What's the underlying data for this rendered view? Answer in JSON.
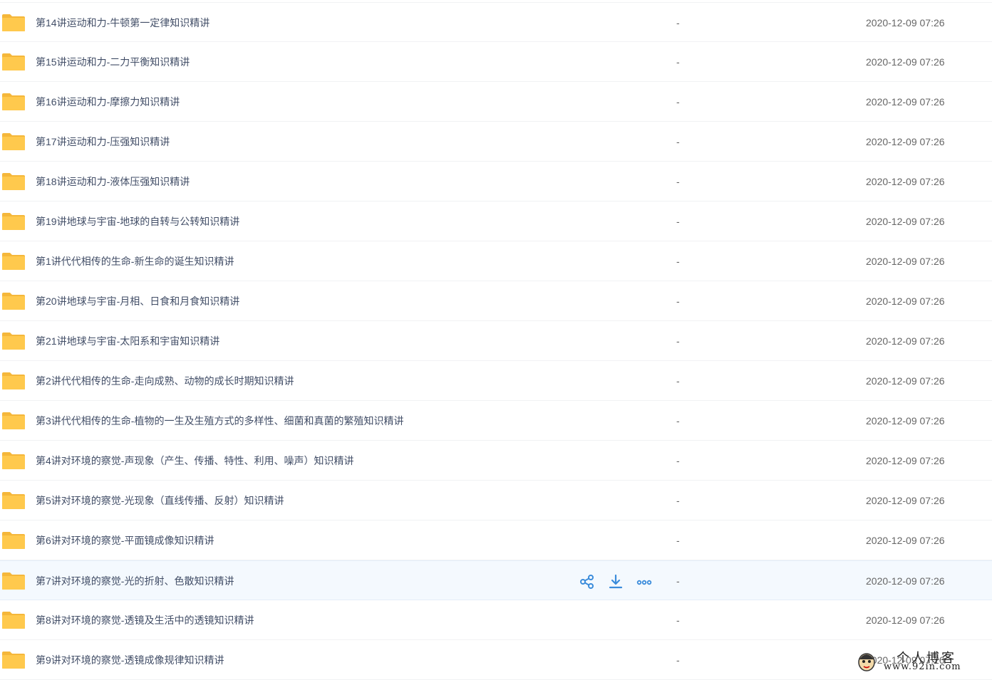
{
  "files": [
    {
      "name": "第14讲运动和力-牛顿第一定律知识精讲",
      "size": "-",
      "time": "2020-12-09 07:26"
    },
    {
      "name": "第15讲运动和力-二力平衡知识精讲",
      "size": "-",
      "time": "2020-12-09 07:26"
    },
    {
      "name": "第16讲运动和力-摩擦力知识精讲",
      "size": "-",
      "time": "2020-12-09 07:26"
    },
    {
      "name": "第17讲运动和力-压强知识精讲",
      "size": "-",
      "time": "2020-12-09 07:26"
    },
    {
      "name": "第18讲运动和力-液体压强知识精讲",
      "size": "-",
      "time": "2020-12-09 07:26"
    },
    {
      "name": "第19讲地球与宇宙-地球的自转与公转知识精讲",
      "size": "-",
      "time": "2020-12-09 07:26"
    },
    {
      "name": "第1讲代代相传的生命-新生命的诞生知识精讲",
      "size": "-",
      "time": "2020-12-09 07:26"
    },
    {
      "name": "第20讲地球与宇宙-月相、日食和月食知识精讲",
      "size": "-",
      "time": "2020-12-09 07:26"
    },
    {
      "name": "第21讲地球与宇宙-太阳系和宇宙知识精讲",
      "size": "-",
      "time": "2020-12-09 07:26"
    },
    {
      "name": "第2讲代代相传的生命-走向成熟、动物的成长时期知识精讲",
      "size": "-",
      "time": "2020-12-09 07:26"
    },
    {
      "name": "第3讲代代相传的生命-植物的一生及生殖方式的多样性、细菌和真菌的繁殖知识精讲",
      "size": "-",
      "time": "2020-12-09 07:26"
    },
    {
      "name": "第4讲对环境的察觉-声现象（产生、传播、特性、利用、噪声）知识精讲",
      "size": "-",
      "time": "2020-12-09 07:26"
    },
    {
      "name": "第5讲对环境的察觉-光现象（直线传播、反射）知识精讲",
      "size": "-",
      "time": "2020-12-09 07:26"
    },
    {
      "name": "第6讲对环境的察觉-平面镜成像知识精讲",
      "size": "-",
      "time": "2020-12-09 07:26"
    },
    {
      "name": "第7讲对环境的察觉-光的折射、色散知识精讲",
      "size": "-",
      "time": "2020-12-09 07:26",
      "hovered": true
    },
    {
      "name": "第8讲对环境的察觉-透镜及生活中的透镜知识精讲",
      "size": "-",
      "time": "2020-12-09 07:26"
    },
    {
      "name": "第9讲对环境的察觉-透镜成像规律知识精讲",
      "size": "-",
      "time": "2020-12-09 07:26"
    }
  ],
  "row_actions": [
    "share-icon",
    "download-icon",
    "more-icon"
  ],
  "colors": {
    "folder": "#ffc94d",
    "accent": "#3b8cdb",
    "name_text": "#424e67",
    "hover_bg": "#f4f9fe"
  },
  "watermark": {
    "title": "个人博客",
    "url": "www.92in.com"
  }
}
